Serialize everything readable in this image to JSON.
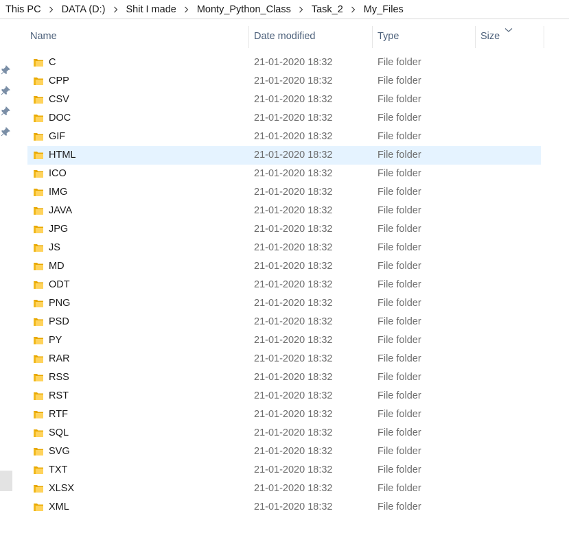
{
  "breadcrumb": [
    "This PC",
    "DATA (D:)",
    "Shit I made",
    "Monty_Python_Class",
    "Task_2",
    "My_Files"
  ],
  "columns": {
    "name": "Name",
    "date": "Date modified",
    "type": "Type",
    "size": "Size"
  },
  "rows": [
    {
      "name": "C",
      "date": "21-01-2020 18:32",
      "type": "File folder"
    },
    {
      "name": "CPP",
      "date": "21-01-2020 18:32",
      "type": "File folder"
    },
    {
      "name": "CSV",
      "date": "21-01-2020 18:32",
      "type": "File folder"
    },
    {
      "name": "DOC",
      "date": "21-01-2020 18:32",
      "type": "File folder"
    },
    {
      "name": "GIF",
      "date": "21-01-2020 18:32",
      "type": "File folder"
    },
    {
      "name": "HTML",
      "date": "21-01-2020 18:32",
      "type": "File folder",
      "selected": true
    },
    {
      "name": "ICO",
      "date": "21-01-2020 18:32",
      "type": "File folder"
    },
    {
      "name": "IMG",
      "date": "21-01-2020 18:32",
      "type": "File folder"
    },
    {
      "name": "JAVA",
      "date": "21-01-2020 18:32",
      "type": "File folder"
    },
    {
      "name": "JPG",
      "date": "21-01-2020 18:32",
      "type": "File folder"
    },
    {
      "name": "JS",
      "date": "21-01-2020 18:32",
      "type": "File folder"
    },
    {
      "name": "MD",
      "date": "21-01-2020 18:32",
      "type": "File folder"
    },
    {
      "name": "ODT",
      "date": "21-01-2020 18:32",
      "type": "File folder"
    },
    {
      "name": "PNG",
      "date": "21-01-2020 18:32",
      "type": "File folder"
    },
    {
      "name": "PSD",
      "date": "21-01-2020 18:32",
      "type": "File folder"
    },
    {
      "name": "PY",
      "date": "21-01-2020 18:32",
      "type": "File folder"
    },
    {
      "name": "RAR",
      "date": "21-01-2020 18:32",
      "type": "File folder"
    },
    {
      "name": "RSS",
      "date": "21-01-2020 18:32",
      "type": "File folder"
    },
    {
      "name": "RST",
      "date": "21-01-2020 18:32",
      "type": "File folder"
    },
    {
      "name": "RTF",
      "date": "21-01-2020 18:32",
      "type": "File folder"
    },
    {
      "name": "SQL",
      "date": "21-01-2020 18:32",
      "type": "File folder"
    },
    {
      "name": "SVG",
      "date": "21-01-2020 18:32",
      "type": "File folder"
    },
    {
      "name": "TXT",
      "date": "21-01-2020 18:32",
      "type": "File folder"
    },
    {
      "name": "XLSX",
      "date": "21-01-2020 18:32",
      "type": "File folder"
    },
    {
      "name": "XML",
      "date": "21-01-2020 18:32",
      "type": "File folder"
    }
  ],
  "icons": {
    "row": "folder-icon",
    "quick_access": "pin-icon",
    "sort": "chevron-down-icon",
    "separator": "chevron-right-icon"
  },
  "colors": {
    "folder_back": "#e8a800",
    "folder_front": "#ffd35c",
    "selection": "#e5f3ff",
    "header_text": "#4c607a"
  }
}
